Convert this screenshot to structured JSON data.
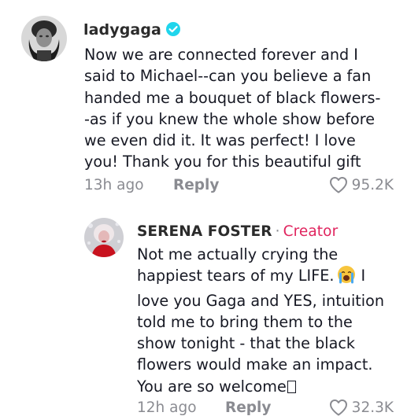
{
  "comments": [
    {
      "username": "ladygaga",
      "verified": true,
      "lines": [
        "Now we are connected forever and I",
        "said to Michael--can you believe a fan",
        "handed me a bouquet of black flowers-",
        "-as if you knew the whole show before",
        "we even did it. It was perfect! I love",
        "you! Thank you for this beautiful gift"
      ],
      "time": "13h ago",
      "reply_label": "Reply",
      "likes": "95.2K"
    },
    {
      "username": "SERENA FOSTER",
      "separator": "·",
      "badge": "Creator",
      "lines": [
        "Not me actually crying the",
        "happiest tears of my LIFE.",
        "love you Gaga and YES, intuition",
        "told me to bring them to the",
        "show tonight - that the black",
        "flowers would make an impact.",
        "You are so welcome"
      ],
      "line2_suffix": " I",
      "time": "12h ago",
      "reply_label": "Reply",
      "likes": "32.3K"
    }
  ],
  "colors": {
    "text": "#161823",
    "muted": "#8a8b91",
    "creator": "#e0245e",
    "verified": "#20d5ec"
  },
  "icons": {
    "verified": "verified-badge-icon",
    "like": "heart-outline-icon",
    "emoji": "crying-face-emoji",
    "missing_glyph": "missing-glyph-box"
  }
}
